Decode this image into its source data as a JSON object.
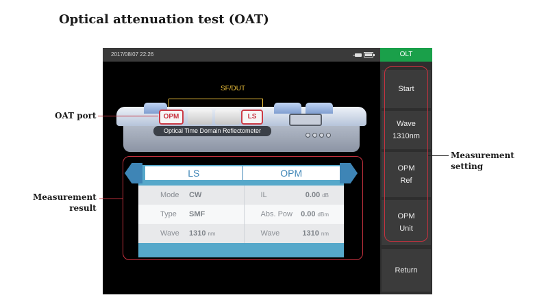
{
  "page_title": "Optical attenuation test (OAT)",
  "status": {
    "datetime": "2017/08/07  22:26",
    "icons": [
      "plug-icon",
      "battery-icon"
    ]
  },
  "device": {
    "sfdut_label": "SF/DUT",
    "port_opm": "OPM",
    "port_ls": "LS",
    "name": "Optical Time Domain Reflectometer"
  },
  "result": {
    "headers": {
      "left": "LS",
      "right": "OPM"
    },
    "rows": [
      {
        "left_label": "Mode",
        "left_value": "CW",
        "left_unit": "",
        "right_label": "IL",
        "right_value": "0.00",
        "right_unit": "dB"
      },
      {
        "left_label": "Type",
        "left_value": "SMF",
        "left_unit": "",
        "right_label": "Abs. Pow",
        "right_value": "0.00",
        "right_unit": "dBm"
      },
      {
        "left_label": "Wave",
        "left_value": "1310",
        "left_unit": "nm",
        "right_label": "Wave",
        "right_value": "1310",
        "right_unit": "nm"
      }
    ]
  },
  "menu": {
    "header": "OLT",
    "start": "Start",
    "wave": "Wave\n1310nm",
    "opm_ref": "OPM\nRef",
    "opm_unit": "OPM\nUnit",
    "return": "Return"
  },
  "callouts": {
    "oat_port": "OAT port",
    "measurement_result": "Measurement\nresult",
    "measurement_setting": "Measurement\nsetting"
  },
  "colors": {
    "accent_green": "#1aa04a",
    "annotation_red": "#c8323f",
    "panel_blue": "#56a8ca",
    "sfdut_yellow": "#f0c33c"
  }
}
